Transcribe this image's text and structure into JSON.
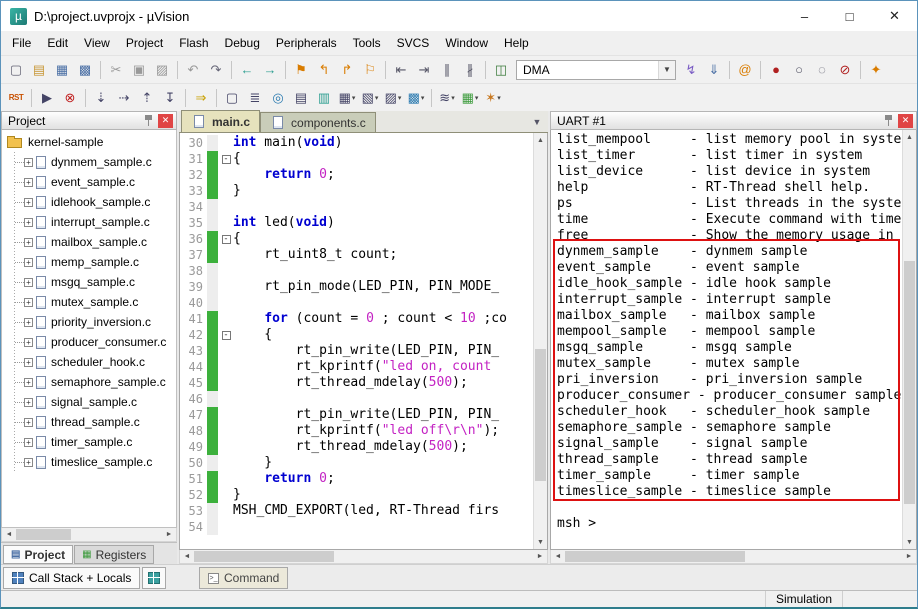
{
  "window": {
    "title": "D:\\project.uvprojx - µVision",
    "minimize": "–",
    "maximize": "□",
    "close": "✕"
  },
  "menu": {
    "items": [
      "File",
      "Edit",
      "View",
      "Project",
      "Flash",
      "Debug",
      "Peripherals",
      "Tools",
      "SVCS",
      "Window",
      "Help"
    ]
  },
  "toolbar1": {
    "items": [
      {
        "type": "icon",
        "name": "new-file",
        "glyph": "▢",
        "color": "#667"
      },
      {
        "type": "icon",
        "name": "open-file",
        "glyph": "▤",
        "color": "#c89838"
      },
      {
        "type": "icon",
        "name": "save",
        "glyph": "▦",
        "color": "#4a6fa5"
      },
      {
        "type": "icon",
        "name": "save-all",
        "glyph": "▩",
        "color": "#4a6fa5"
      },
      {
        "type": "sep"
      },
      {
        "type": "icon",
        "name": "cut",
        "glyph": "✂",
        "color": "#999"
      },
      {
        "type": "icon",
        "name": "copy",
        "glyph": "▣",
        "color": "#999"
      },
      {
        "type": "icon",
        "name": "paste",
        "glyph": "▨",
        "color": "#999"
      },
      {
        "type": "sep"
      },
      {
        "type": "icon",
        "name": "undo",
        "glyph": "↶",
        "color": "#999"
      },
      {
        "type": "icon",
        "name": "redo",
        "glyph": "↷",
        "color": "#667"
      },
      {
        "type": "sep"
      },
      {
        "type": "icon",
        "name": "navigate-back",
        "glyph": "←",
        "color": "#2a9d8f"
      },
      {
        "type": "icon",
        "name": "navigate-forward",
        "glyph": "→",
        "color": "#2a9d8f"
      },
      {
        "type": "sep"
      },
      {
        "type": "icon",
        "name": "toggle-bookmark",
        "glyph": "⚑",
        "color": "#d97c00"
      },
      {
        "type": "icon",
        "name": "prev-bookmark",
        "glyph": "↰",
        "color": "#d97c00"
      },
      {
        "type": "icon",
        "name": "next-bookmark",
        "glyph": "↱",
        "color": "#d97c00"
      },
      {
        "type": "icon",
        "name": "clear-all-bookmarks",
        "glyph": "⚐",
        "color": "#d97c00"
      },
      {
        "type": "sep"
      },
      {
        "type": "icon",
        "name": "unindent",
        "glyph": "⇤",
        "color": "#556"
      },
      {
        "type": "icon",
        "name": "indent",
        "glyph": "⇥",
        "color": "#556"
      },
      {
        "type": "icon",
        "name": "comment-selection",
        "glyph": "∥",
        "color": "#556"
      },
      {
        "type": "icon",
        "name": "uncomment-selection",
        "glyph": "∦",
        "color": "#556"
      },
      {
        "type": "sep"
      },
      {
        "type": "icon",
        "name": "select-target-icon",
        "glyph": "◫",
        "color": "#3a7a3a"
      },
      {
        "type": "combo",
        "name": "target-select",
        "value": "DMA"
      },
      {
        "type": "icon",
        "name": "flash-download",
        "glyph": "↯",
        "color": "#7a5cc4"
      },
      {
        "type": "icon",
        "name": "load-application",
        "glyph": "⇓",
        "color": "#4a6fa5"
      },
      {
        "type": "sep"
      },
      {
        "type": "icon",
        "name": "find-in-files",
        "glyph": "@",
        "color": "#d97c00"
      },
      {
        "type": "sep"
      },
      {
        "type": "icon",
        "name": "insert-breakpoint",
        "glyph": "●",
        "color": "#b02020"
      },
      {
        "type": "icon",
        "name": "enable-disable-breakpoint",
        "glyph": "○",
        "color": "#556"
      },
      {
        "type": "icon",
        "name": "disable-all-breakpoints",
        "glyph": "◌",
        "color": "#556"
      },
      {
        "type": "icon",
        "name": "kill-all-breakpoints",
        "glyph": "⊘",
        "color": "#b02020"
      },
      {
        "type": "sep"
      },
      {
        "type": "icon",
        "name": "flash-configure",
        "glyph": "✦",
        "color": "#d97c00"
      }
    ]
  },
  "toolbar2": {
    "items": [
      {
        "type": "label",
        "name": "reset-cpu",
        "text": "RST",
        "color": "#c85000"
      },
      {
        "type": "sep"
      },
      {
        "type": "icon",
        "name": "run-button",
        "glyph": "▶",
        "color": "#446"
      },
      {
        "type": "icon",
        "name": "stop-debug",
        "glyph": "⊗",
        "color": "#c02020"
      },
      {
        "type": "sep"
      },
      {
        "type": "icon",
        "name": "step-into",
        "glyph": "⇣",
        "color": "#446"
      },
      {
        "type": "icon",
        "name": "step-over",
        "glyph": "⇢",
        "color": "#446"
      },
      {
        "type": "icon",
        "name": "step-out",
        "glyph": "⇡",
        "color": "#446"
      },
      {
        "type": "icon",
        "name": "run-to-cursor",
        "glyph": "↧",
        "color": "#446"
      },
      {
        "type": "sep"
      },
      {
        "type": "icon",
        "name": "show-next-statement",
        "glyph": "⇒",
        "color": "#c8a000"
      },
      {
        "type": "sep"
      },
      {
        "type": "icon",
        "name": "command-window",
        "glyph": "▢",
        "color": "#446"
      },
      {
        "type": "icon",
        "name": "disassembly-window",
        "glyph": "≣",
        "color": "#446"
      },
      {
        "type": "icon",
        "name": "symbol-window",
        "glyph": "◎",
        "color": "#2a7ab0"
      },
      {
        "type": "icon",
        "name": "registers-window",
        "glyph": "▤",
        "color": "#446"
      },
      {
        "type": "icon",
        "name": "call-stack-window",
        "glyph": "▥",
        "color": "#2a9d8f"
      },
      {
        "type": "icon",
        "name": "watch-windows",
        "glyph": "▦",
        "color": "#446",
        "dd": true
      },
      {
        "type": "icon",
        "name": "memory-windows",
        "glyph": "▧",
        "color": "#446",
        "dd": true
      },
      {
        "type": "icon",
        "name": "serial-windows",
        "glyph": "▨",
        "color": "#446",
        "dd": true
      },
      {
        "type": "icon",
        "name": "analysis-windows",
        "glyph": "▩",
        "color": "#2a7ab0",
        "dd": true
      },
      {
        "type": "sep"
      },
      {
        "type": "icon",
        "name": "trace-windows",
        "glyph": "≋",
        "color": "#446",
        "dd": true
      },
      {
        "type": "icon",
        "name": "system-viewer",
        "glyph": "▦",
        "color": "#3a9a3a",
        "dd": true
      },
      {
        "type": "icon",
        "name": "toolbox",
        "glyph": "✶",
        "color": "#c87820",
        "dd": true
      }
    ]
  },
  "project_panel": {
    "title": "Project",
    "root": "kernel-sample",
    "files": [
      "dynmem_sample.c",
      "event_sample.c",
      "idlehook_sample.c",
      "interrupt_sample.c",
      "mailbox_sample.c",
      "memp_sample.c",
      "msgq_sample.c",
      "mutex_sample.c",
      "priority_inversion.c",
      "producer_consumer.c",
      "scheduler_hook.c",
      "semaphore_sample.c",
      "signal_sample.c",
      "thread_sample.c",
      "timer_sample.c",
      "timeslice_sample.c"
    ],
    "tabs": [
      "Project",
      "Registers"
    ]
  },
  "editor": {
    "tabs": [
      "main.c",
      "components.c"
    ],
    "lines": [
      {
        "no": 30,
        "green": false,
        "fold": false,
        "tokens": [
          [
            "int",
            "kw"
          ],
          [
            " main(",
            "pl"
          ],
          [
            "void",
            "kw"
          ],
          [
            ")",
            "pl"
          ]
        ]
      },
      {
        "no": 31,
        "green": true,
        "fold": true,
        "tokens": [
          [
            "{",
            "pl"
          ]
        ]
      },
      {
        "no": 32,
        "green": true,
        "fold": false,
        "tokens": [
          [
            "    ",
            "pl"
          ],
          [
            "return",
            "kw"
          ],
          [
            " ",
            "pl"
          ],
          [
            "0",
            "num"
          ],
          [
            ";",
            "pl"
          ]
        ]
      },
      {
        "no": 33,
        "green": true,
        "fold": false,
        "tokens": [
          [
            "}",
            "pl"
          ]
        ]
      },
      {
        "no": 34,
        "green": false,
        "fold": false,
        "tokens": []
      },
      {
        "no": 35,
        "green": false,
        "fold": false,
        "tokens": [
          [
            "int",
            "kw"
          ],
          [
            " led(",
            "pl"
          ],
          [
            "void",
            "kw"
          ],
          [
            ")",
            "pl"
          ]
        ]
      },
      {
        "no": 36,
        "green": true,
        "fold": true,
        "tokens": [
          [
            "{",
            "pl"
          ]
        ]
      },
      {
        "no": 37,
        "green": true,
        "fold": false,
        "tokens": [
          [
            "    rt_uint8_t count;",
            "pl"
          ]
        ]
      },
      {
        "no": 38,
        "green": false,
        "fold": false,
        "tokens": []
      },
      {
        "no": 39,
        "green": false,
        "fold": false,
        "tokens": [
          [
            "    rt_pin_mode(LED_PIN, PIN_MODE_",
            "pl"
          ]
        ]
      },
      {
        "no": 40,
        "green": false,
        "fold": false,
        "tokens": []
      },
      {
        "no": 41,
        "green": true,
        "fold": false,
        "tokens": [
          [
            "    ",
            "pl"
          ],
          [
            "for",
            "kw"
          ],
          [
            " (count = ",
            "pl"
          ],
          [
            "0",
            "num"
          ],
          [
            " ; count < ",
            "pl"
          ],
          [
            "10",
            "num"
          ],
          [
            " ;co",
            "pl"
          ]
        ]
      },
      {
        "no": 42,
        "green": true,
        "fold": true,
        "tokens": [
          [
            "    {",
            "pl"
          ]
        ]
      },
      {
        "no": 43,
        "green": true,
        "fold": false,
        "tokens": [
          [
            "        rt_pin_write(LED_PIN, PIN_",
            "pl"
          ]
        ]
      },
      {
        "no": 44,
        "green": true,
        "fold": false,
        "tokens": [
          [
            "        rt_kprintf(",
            "pl"
          ],
          [
            "\"led on, count",
            "str"
          ]
        ]
      },
      {
        "no": 45,
        "green": true,
        "fold": false,
        "tokens": [
          [
            "        rt_thread_mdelay(",
            "pl"
          ],
          [
            "500",
            "num"
          ],
          [
            ");",
            "pl"
          ]
        ]
      },
      {
        "no": 46,
        "green": false,
        "fold": false,
        "tokens": []
      },
      {
        "no": 47,
        "green": true,
        "fold": false,
        "tokens": [
          [
            "        rt_pin_write(LED_PIN, PIN_",
            "pl"
          ]
        ]
      },
      {
        "no": 48,
        "green": true,
        "fold": false,
        "tokens": [
          [
            "        rt_kprintf(",
            "pl"
          ],
          [
            "\"led off\\r\\n\"",
            "str"
          ],
          [
            ");",
            "pl"
          ]
        ]
      },
      {
        "no": 49,
        "green": true,
        "fold": false,
        "tokens": [
          [
            "        rt_thread_mdelay(",
            "pl"
          ],
          [
            "500",
            "num"
          ],
          [
            ");",
            "pl"
          ]
        ]
      },
      {
        "no": 50,
        "green": false,
        "fold": false,
        "tokens": [
          [
            "    }",
            "pl"
          ]
        ]
      },
      {
        "no": 51,
        "green": true,
        "fold": false,
        "tokens": [
          [
            "    ",
            "pl"
          ],
          [
            "return",
            "kw"
          ],
          [
            " ",
            "pl"
          ],
          [
            "0",
            "num"
          ],
          [
            ";",
            "pl"
          ]
        ]
      },
      {
        "no": 52,
        "green": true,
        "fold": false,
        "tokens": [
          [
            "}",
            "pl"
          ]
        ]
      },
      {
        "no": 53,
        "green": false,
        "fold": false,
        "tokens": [
          [
            "MSH_CMD_EXPORT(led, RT-Thread firs",
            "pl"
          ]
        ]
      },
      {
        "no": 54,
        "green": false,
        "fold": false,
        "tokens": []
      }
    ]
  },
  "uart": {
    "title": "UART #1",
    "lines": [
      "list_mempool     - list memory pool in system",
      "list_timer       - list timer in system",
      "list_device      - list device in system",
      "help             - RT-Thread shell help.",
      "ps               - List threads in the system.",
      "time             - Execute command with time.",
      "free             - Show the memory usage in the system.",
      "dynmem_sample    - dynmem sample",
      "event_sample     - event sample",
      "idle_hook_sample - idle hook sample",
      "interrupt_sample - interrupt sample",
      "mailbox_sample   - mailbox sample",
      "mempool_sample   - mempool sample",
      "msgq_sample      - msgq sample",
      "mutex_sample     - mutex sample",
      "pri_inversion    - pri_inversion sample",
      "producer_consumer - producer_consumer sample",
      "scheduler_hook   - scheduler_hook sample",
      "semaphore_sample - semaphore sample",
      "signal_sample    - signal sample",
      "thread_sample    - thread sample",
      "timer_sample     - timer sample",
      "timeslice_sample - timeslice sample",
      "",
      "msh >"
    ]
  },
  "bottom": {
    "call_stack_tab": "Call Stack + Locals",
    "command_tab": "Command"
  },
  "status": {
    "mode": "Simulation"
  }
}
